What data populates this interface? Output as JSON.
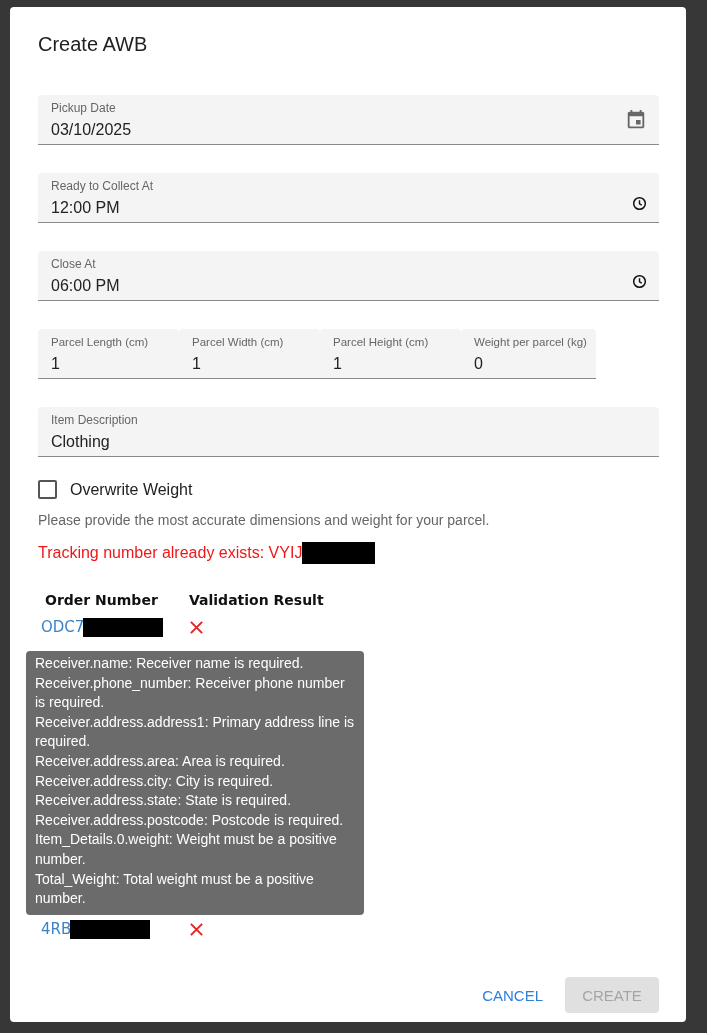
{
  "dialog": {
    "title": "Create AWB"
  },
  "fields": [
    {
      "label": "Pickup Date",
      "value": "03/10/2025",
      "kind": "date"
    },
    {
      "label": "Ready to Collect At",
      "value": "12:00 PM",
      "kind": "time"
    },
    {
      "label": "Close At",
      "value": "06:00 PM",
      "kind": "time"
    }
  ],
  "parcel_fields": [
    {
      "label": "Parcel Length (cm)",
      "value": "1"
    },
    {
      "label": "Parcel Width (cm)",
      "value": "1"
    },
    {
      "label": "Parcel Height (cm)",
      "value": "1"
    },
    {
      "label": "Weight per parcel (kg)",
      "value": "0"
    }
  ],
  "description_field": {
    "label": "Item Description",
    "value": "Clothing"
  },
  "overwrite_weight": {
    "label": "Overwrite Weight",
    "checked": false
  },
  "helper_text": "Please provide the most accurate dimensions and weight for your parcel.",
  "error": {
    "text": "Tracking number already exists: VYIJ",
    "redacted": true
  },
  "table": {
    "columns": [
      "Order Number",
      "Validation Result"
    ],
    "rows": [
      {
        "order": "ODC7",
        "redacted": true,
        "valid": false
      },
      {
        "order": "4RB",
        "redacted": true,
        "valid": false
      }
    ]
  },
  "tooltip": {
    "lines": [
      "Receiver.name: Receiver name is required.",
      "Receiver.phone_number: Receiver phone number is required.",
      "Receiver.address.address1: Primary address line is required.",
      "Receiver.address.area: Area is required.",
      "Receiver.address.city: City is required.",
      "Receiver.address.state: State is required.",
      "Receiver.address.postcode: Postcode is required.",
      "Item_Details.0.weight: Weight must be a positive number.",
      "Total_Weight: Total weight must be a positive number."
    ]
  },
  "buttons": [
    {
      "label": "CANCEL",
      "disabled": false
    },
    {
      "label": "CREATE",
      "disabled": true
    }
  ]
}
